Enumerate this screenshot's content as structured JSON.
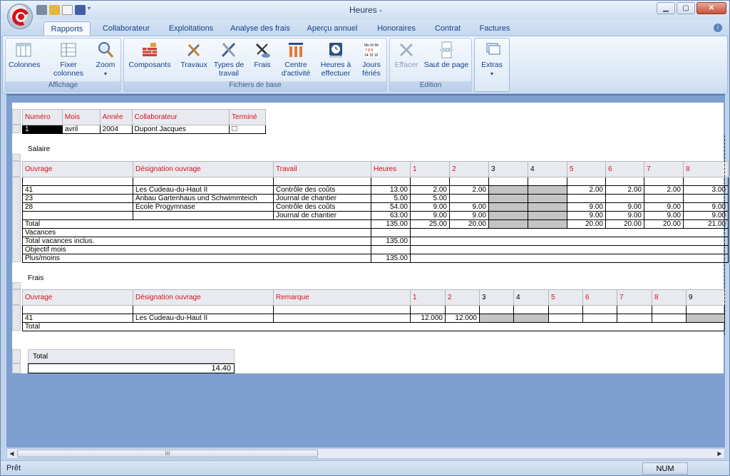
{
  "window": {
    "title": "Heures -"
  },
  "tabs": [
    "Rapports",
    "Collaborateur",
    "Exploitations",
    "Analyse des frais",
    "Aperçu annuel",
    "Honoraires",
    "Contrat",
    "Factures"
  ],
  "ribbon": {
    "affichage": {
      "label": "Affichage",
      "buttons": [
        "Colonnes",
        "Fixer colonnes",
        "Zoom"
      ]
    },
    "fichiers": {
      "label": "Fichiers de base",
      "buttons": [
        "Composants",
        "Travaux",
        "Types de travail",
        "Frais",
        "Centre d'activité",
        "Heures à effectuer",
        "Jours fériés"
      ]
    },
    "edition": {
      "label": "Edition",
      "buttons": [
        "Effacer",
        "Saut de page"
      ]
    },
    "extras": {
      "label": "Extras"
    }
  },
  "header_table": {
    "columns": [
      "Numéro",
      "Mois",
      "Année",
      "Collaborateur",
      "Terminé"
    ],
    "row": [
      "1",
      "avril",
      "2004",
      "Dupont Jacques",
      ""
    ]
  },
  "salaire": {
    "title": "Salaire",
    "columns": [
      "Ouvrage",
      "Désignation ouvrage",
      "Travail",
      "Heures",
      "1",
      "2",
      "3",
      "4",
      "5",
      "6",
      "7",
      "8"
    ],
    "rows": [
      [
        "41",
        "Les Cudeau-du-Haut II",
        "Contrôle des coûts",
        "13.00",
        "2.00",
        "2.00",
        "",
        "",
        "2.00",
        "2.00",
        "2.00",
        "3.00"
      ],
      [
        "23",
        "Anbau Gartenhaus und Schwimmteich",
        "Journal de chantier",
        "5.00",
        "5.00",
        "",
        "",
        "",
        "",
        "",
        "",
        ""
      ],
      [
        "28",
        "Ecole Progymnase",
        "Contrôle des coûts",
        "54.00",
        "9.00",
        "9.00",
        "",
        "",
        "9.00",
        "9.00",
        "9.00",
        "9.00"
      ],
      [
        "",
        "",
        "Journal de chantier",
        "63.00",
        "9.00",
        "9.00",
        "",
        "",
        "9.00",
        "9.00",
        "9.00",
        "9.00"
      ]
    ],
    "total": {
      "label": "Total",
      "heures": "135.00",
      "days": [
        "25.00",
        "20.00",
        "",
        "",
        "20.00",
        "20.00",
        "20.00",
        "21.00"
      ]
    },
    "summary": [
      {
        "label": "Vacances",
        "value": ""
      },
      {
        "label": "Total vacances inclus.",
        "value": "135.00"
      },
      {
        "label": "Objectif mois",
        "value": ""
      },
      {
        "label": "Plus/moins",
        "value": "135.00"
      }
    ]
  },
  "frais": {
    "title": "Frais",
    "columns": [
      "Ouvrage",
      "Désignation ouvrage",
      "Remarque",
      "1",
      "2",
      "3",
      "4",
      "5",
      "6",
      "7",
      "8",
      "9"
    ],
    "row": [
      "41",
      "Les Cudeau-du-Haut II",
      "",
      "12.000",
      "12.000",
      "",
      "",
      "",
      "",
      "",
      "",
      ""
    ],
    "total_label": "Total"
  },
  "grand_total": {
    "label": "Total",
    "value": "14.40"
  },
  "statusbar": {
    "text": "Prêt",
    "num": "NUM"
  },
  "scroll_grip": "III"
}
